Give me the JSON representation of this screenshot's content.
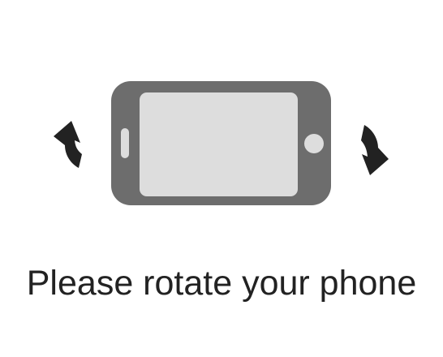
{
  "message": "Please rotate your phone",
  "icons": {
    "phone": "phone-landscape-icon",
    "left_arrow": "rotate-arrow-left-icon",
    "right_arrow": "rotate-arrow-right-icon"
  },
  "colors": {
    "background": "#ffffff",
    "phone_body": "#6d6d6d",
    "phone_screen": "#dddddd",
    "arrows": "#222222",
    "text": "#222222"
  }
}
